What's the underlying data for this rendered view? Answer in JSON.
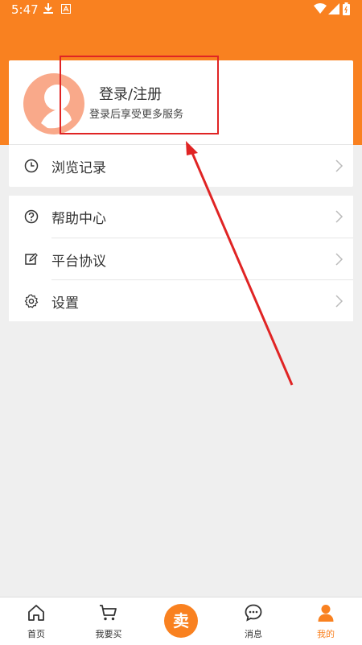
{
  "status_bar": {
    "time": "5:47"
  },
  "profile": {
    "login_title": "登录/注册",
    "login_subtitle": "登录后享受更多服务"
  },
  "menu_group_1": [
    {
      "label": "浏览记录",
      "icon": "clock-icon"
    }
  ],
  "menu_group_2": [
    {
      "label": "帮助中心",
      "icon": "help-icon"
    },
    {
      "label": "平台协议",
      "icon": "edit-document-icon"
    },
    {
      "label": "设置",
      "icon": "gear-icon"
    }
  ],
  "tabbar": {
    "items": [
      {
        "label": "首页",
        "icon": "home-icon"
      },
      {
        "label": "我要买",
        "icon": "cart-icon"
      },
      {
        "label": "卖",
        "icon": "sell-button"
      },
      {
        "label": "消息",
        "icon": "message-icon"
      },
      {
        "label": "我的",
        "icon": "user-icon"
      }
    ],
    "active_index": 4
  },
  "colors": {
    "accent": "#f98120",
    "annotation": "#e02424",
    "background": "#efefef"
  }
}
